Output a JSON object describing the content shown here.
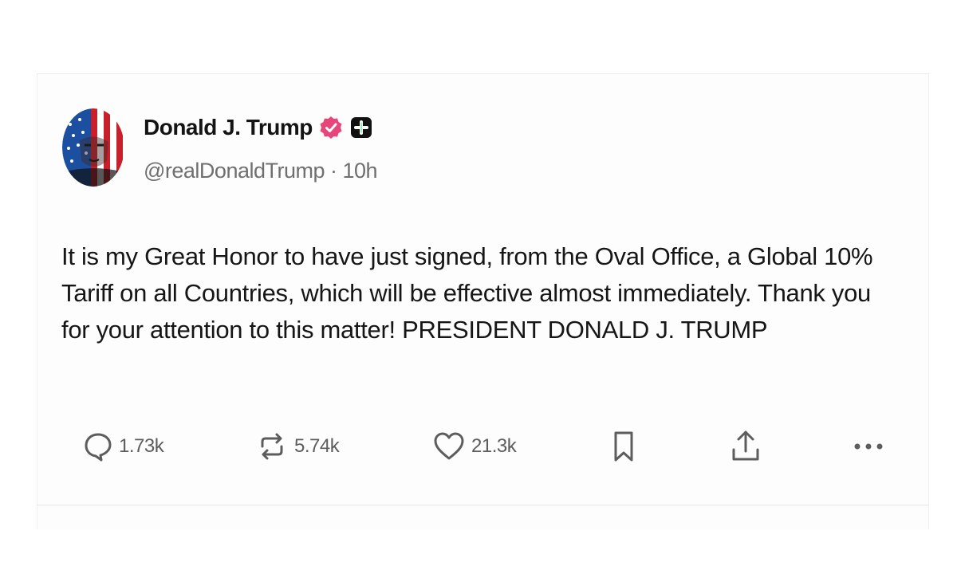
{
  "post": {
    "author": {
      "display_name": "Donald J. Trump",
      "handle": "@realDonaldTrump",
      "separator": "·",
      "time_ago": "10h"
    },
    "text": "It is my Great Honor to have just signed, from the Oval Office, a Global 10% Tariff on all Countries, which will be effective almost immediately. Thank you for your attention to this matter! PRESIDENT DONALD J. TRUMP",
    "actions": {
      "replies": "1.73k",
      "reposts": "5.74k",
      "likes": "21.3k"
    }
  },
  "icons": {
    "verified": "verified-badge-icon",
    "plus": "plus-badge-icon",
    "reply": "reply-icon",
    "repost": "repost-icon",
    "like": "heart-icon",
    "bookmark": "bookmark-icon",
    "share": "share-icon",
    "more": "more-icon"
  },
  "colors": {
    "verified_badge": "#e8457b",
    "text": "#161616",
    "muted": "#6f6f6f"
  }
}
